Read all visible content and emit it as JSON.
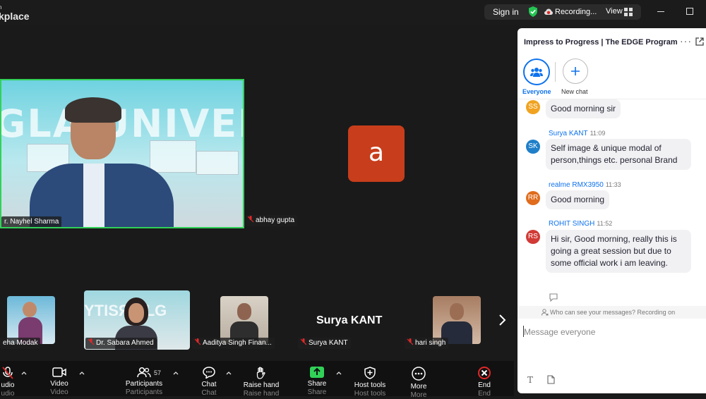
{
  "titlebar": {
    "logo_line1": "n",
    "logo_line2": "kplace",
    "signin": "Sign in",
    "recording": "Recording...",
    "view": "View"
  },
  "stage": {
    "main_video_name": "r. Nayhel Sharma",
    "main_video_bg_text": "GLA UNIVERSITY",
    "avatar_letter": "a",
    "avatar_name": "abhay gupta",
    "thumbnails": [
      {
        "name": "eha Modak"
      },
      {
        "name": "Dr. Sabara Ahmed"
      },
      {
        "name": "Aaditya Singh Finan..."
      },
      {
        "name": "Surya KANT"
      },
      {
        "name": "hari singh"
      }
    ],
    "surya_big": "Surya KANT"
  },
  "toolbar": {
    "audio": "udio",
    "audio2": "udio",
    "video": "Video",
    "video2": "Video",
    "participants": "Participants",
    "participants2": "Participants",
    "participants_count": "57",
    "chat": "Chat",
    "chat2": "Chat",
    "raise": "Raise hand",
    "raise2": "Raise hand",
    "share": "Share",
    "share2": "Share",
    "host": "Host tools",
    "host2": "Host tools",
    "more": "More",
    "more2": "More",
    "end": "End",
    "end2": "End"
  },
  "chat": {
    "title": "Impress to Progress | The EDGE Program",
    "everyone_label": "Everyone",
    "new_chat_label": "New chat",
    "messages": [
      {
        "initials": "SS",
        "color": "#f0a321",
        "sender": "",
        "time": "",
        "text": "Good morning sir"
      },
      {
        "initials": "SK",
        "color": "#1f7fc9",
        "sender": "Surya KANT",
        "time": "11:09",
        "text": "Self image & unique modal of person,things etc. personal Brand"
      },
      {
        "initials": "RR",
        "color": "#e06c1c",
        "sender": "realme RMX3950",
        "time": "11:33",
        "text": "Good morning"
      },
      {
        "initials": "RS",
        "color": "#d13a36",
        "sender": "ROHIT SINGH",
        "time": "11:52",
        "text": "Hi sir, Good morning, really this is going a great session but due to some official work i am leaving."
      }
    ],
    "info": "Who can see your messages? Recording on",
    "placeholder": "Message everyone"
  },
  "colors": {
    "accent": "#0e72ed",
    "active_speaker": "#31d158",
    "avatar_a": "#c83d1b",
    "share_green": "#31d158",
    "end_red": "#e02828"
  }
}
